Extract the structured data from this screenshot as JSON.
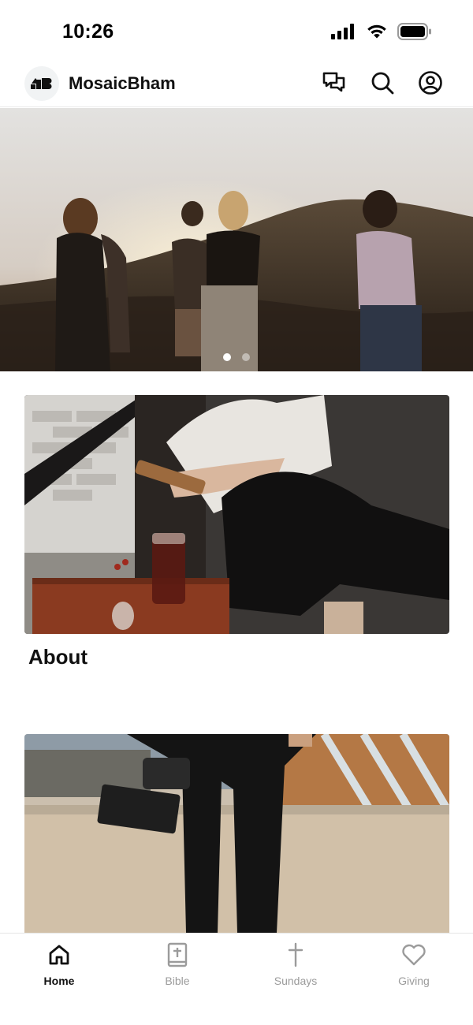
{
  "status_bar": {
    "time": "10:26",
    "icons": [
      "cellular-signal-icon",
      "wifi-icon",
      "battery-icon"
    ]
  },
  "header": {
    "logo_icon": "mosaic-logo",
    "title": "MosaicBham",
    "actions": [
      {
        "icon": "chat-icon"
      },
      {
        "icon": "search-icon"
      },
      {
        "icon": "account-icon"
      }
    ]
  },
  "hero_carousel": {
    "page_count": 2,
    "active_index": 0
  },
  "cards": [
    {
      "title": "About"
    },
    {
      "title": ""
    }
  ],
  "tabbar": {
    "tabs": [
      {
        "label": "Home",
        "icon": "home-icon",
        "active": true
      },
      {
        "label": "Bible",
        "icon": "bible-icon",
        "active": false
      },
      {
        "label": "Sundays",
        "icon": "cross-icon",
        "active": false
      },
      {
        "label": "Giving",
        "icon": "heart-icon",
        "active": false
      }
    ]
  },
  "colors": {
    "active_tab": "#111111",
    "inactive_tab": "#9b9b9b",
    "background": "#ffffff"
  }
}
